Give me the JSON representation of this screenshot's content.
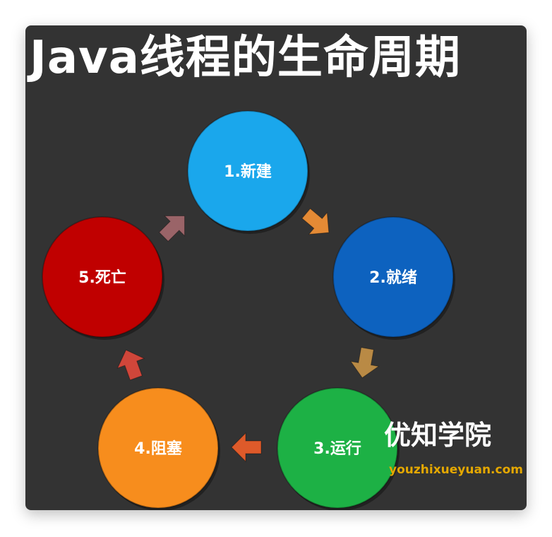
{
  "title": "Java线程的生命周期",
  "nodes": [
    {
      "label": "1.新建",
      "color": "#1aa7ec"
    },
    {
      "label": "2.就绪",
      "color": "#0d62bf"
    },
    {
      "label": "3.运行",
      "color": "#1db145"
    },
    {
      "label": "4.阻塞",
      "color": "#f78d1d"
    },
    {
      "label": "5.死亡",
      "color": "#c00000"
    }
  ],
  "arrows": [
    {
      "from": "1.新建",
      "to": "2.就绪",
      "color": "#e48a35"
    },
    {
      "from": "2.就绪",
      "to": "3.运行",
      "color": "#b98a45"
    },
    {
      "from": "3.运行",
      "to": "4.阻塞",
      "color": "#de5a2a"
    },
    {
      "from": "4.阻塞",
      "to": "5.死亡",
      "color": "#d0463a"
    },
    {
      "from": "5.死亡",
      "to": "1.新建",
      "color": "#9a6468"
    }
  ],
  "watermark": {
    "name": "优知学院",
    "url": "youzhixueyuan.com"
  },
  "background": "#333333"
}
